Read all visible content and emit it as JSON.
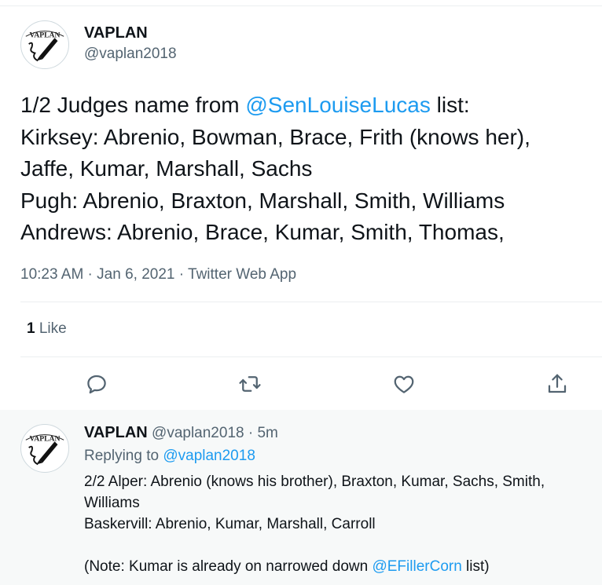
{
  "main_tweet": {
    "author_name": "VAPLAN",
    "author_handle": "@vaplan2018",
    "avatar_logo_text": "VAPLAN",
    "text_line1_prefix": "1/2 Judges name from ",
    "text_line1_mention": "@SenLouiseLucas",
    "text_line1_suffix": " list:",
    "text_line2": "Kirksey: Abrenio, Bowman, Brace, Frith (knows her),",
    "text_line3": "Jaffe, Kumar, Marshall, Sachs",
    "text_line4": "Pugh: Abrenio, Braxton, Marshall, Smith, Williams",
    "text_line5": "Andrews: Abrenio, Brace, Kumar, Smith, Thomas,",
    "time": "10:23 AM",
    "dot1": " · ",
    "date": "Jan 6, 2021",
    "dot2": " · ",
    "source": "Twitter Web App",
    "like_count": "1",
    "like_label": " Like"
  },
  "actions": {
    "reply_icon": "reply-icon",
    "retweet_icon": "retweet-icon",
    "like_icon": "heart-icon",
    "share_icon": "share-icon"
  },
  "reply_tweet": {
    "author_name": "VAPLAN",
    "author_handle": " @vaplan2018",
    "time_sep": " · ",
    "time_ago": "5m",
    "replying_prefix": "Replying to ",
    "replying_handle": "@vaplan2018",
    "text_line1": "2/2 Alper: Abrenio (knows his brother), Braxton, Kumar, Sachs, Smith,",
    "text_line2": "Williams",
    "text_line3": "Baskervill: Abrenio, Kumar, Marshall, Carroll",
    "text_line4_prefix": "(Note: Kumar is already on narrowed down ",
    "text_line4_mention": "@EFillerCorn",
    "text_line4_suffix": " list)"
  },
  "colors": {
    "link": "#1d9bf0",
    "secondary_text": "#536471",
    "primary_text": "#0f1419",
    "reply_background": "#f7f9f9"
  }
}
